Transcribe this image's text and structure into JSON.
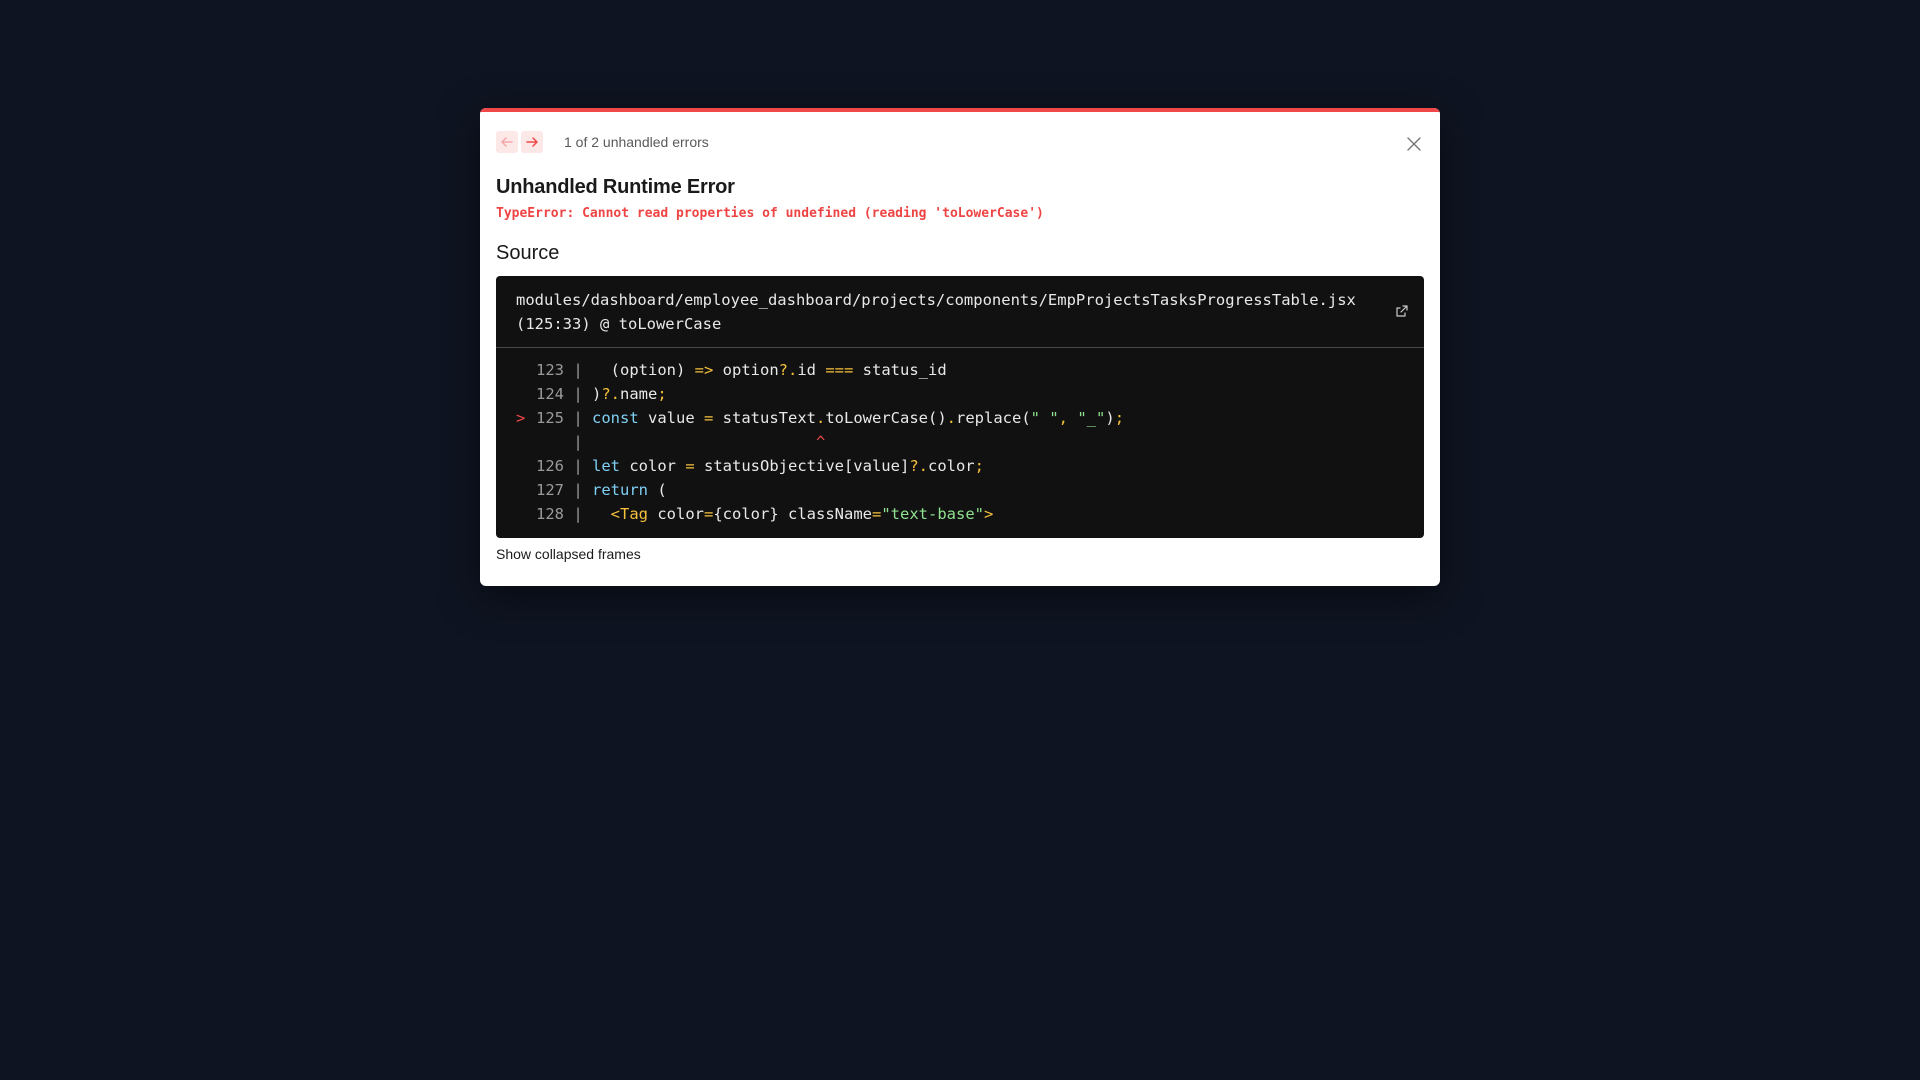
{
  "overlay": {
    "pagination": {
      "prev_icon": "arrow-left-icon",
      "next_icon": "arrow-right-icon",
      "count_text": "1 of 2 unhandled errors"
    },
    "close_icon": "close-icon",
    "title": "Unhandled Runtime Error",
    "message": "TypeError: Cannot read properties of undefined (reading 'toLowerCase')",
    "source_heading": "Source",
    "source": {
      "file_line1": "modules/dashboard/employee_dashboard/projects/components/EmpProjectsTasksProgressTable.jsx",
      "file_line2": "(125:33) @ toLowerCase",
      "external_icon": "external-link-icon",
      "lines": [
        {
          "marker": "",
          "num": "123",
          "sep": "|",
          "tokens": [
            {
              "t": "  (option) ",
              "c": ""
            },
            {
              "t": "=>",
              "c": "op"
            },
            {
              "t": " option",
              "c": ""
            },
            {
              "t": "?.",
              "c": "op"
            },
            {
              "t": "id ",
              "c": ""
            },
            {
              "t": "===",
              "c": "op"
            },
            {
              "t": " status_id",
              "c": ""
            }
          ]
        },
        {
          "marker": "",
          "num": "124",
          "sep": "|",
          "tokens": [
            {
              "t": ")",
              "c": ""
            },
            {
              "t": "?.",
              "c": "op"
            },
            {
              "t": "name",
              "c": ""
            },
            {
              "t": ";",
              "c": "op"
            }
          ]
        },
        {
          "marker": ">",
          "num": "125",
          "sep": "|",
          "tokens": [
            {
              "t": "const",
              "c": "kw"
            },
            {
              "t": " value ",
              "c": ""
            },
            {
              "t": "=",
              "c": "op"
            },
            {
              "t": " statusText",
              "c": ""
            },
            {
              "t": ".",
              "c": "op"
            },
            {
              "t": "toLowerCase()",
              "c": ""
            },
            {
              "t": ".",
              "c": "op"
            },
            {
              "t": "replace(",
              "c": ""
            },
            {
              "t": "\" \"",
              "c": "str"
            },
            {
              "t": ", ",
              "c": "op"
            },
            {
              "t": "\"_\"",
              "c": "str"
            },
            {
              "t": ")",
              "c": ""
            },
            {
              "t": ";",
              "c": "op"
            }
          ]
        },
        {
          "marker": "",
          "num": "",
          "sep": "|",
          "tokens": [
            {
              "t": "                        ^",
              "c": "caret"
            }
          ]
        },
        {
          "marker": "",
          "num": "126",
          "sep": "|",
          "tokens": [
            {
              "t": "let",
              "c": "kw"
            },
            {
              "t": " color ",
              "c": ""
            },
            {
              "t": "=",
              "c": "op"
            },
            {
              "t": " statusObjective[value]",
              "c": ""
            },
            {
              "t": "?.",
              "c": "op"
            },
            {
              "t": "color",
              "c": ""
            },
            {
              "t": ";",
              "c": "op"
            }
          ]
        },
        {
          "marker": "",
          "num": "127",
          "sep": "|",
          "tokens": [
            {
              "t": "return",
              "c": "kw"
            },
            {
              "t": " (",
              "c": ""
            }
          ]
        },
        {
          "marker": "",
          "num": "128",
          "sep": "|",
          "tokens": [
            {
              "t": "  <Tag",
              "c": "tag"
            },
            {
              "t": " color",
              "c": ""
            },
            {
              "t": "=",
              "c": "op"
            },
            {
              "t": "{color} className",
              "c": ""
            },
            {
              "t": "=",
              "c": "op"
            },
            {
              "t": "\"text-base\"",
              "c": "str"
            },
            {
              "t": ">",
              "c": "tag"
            }
          ]
        }
      ]
    },
    "show_frames_label": "Show collapsed frames",
    "colors": {
      "accent": "#f04848",
      "background": "#0f1422",
      "code_bg": "#111111"
    }
  }
}
